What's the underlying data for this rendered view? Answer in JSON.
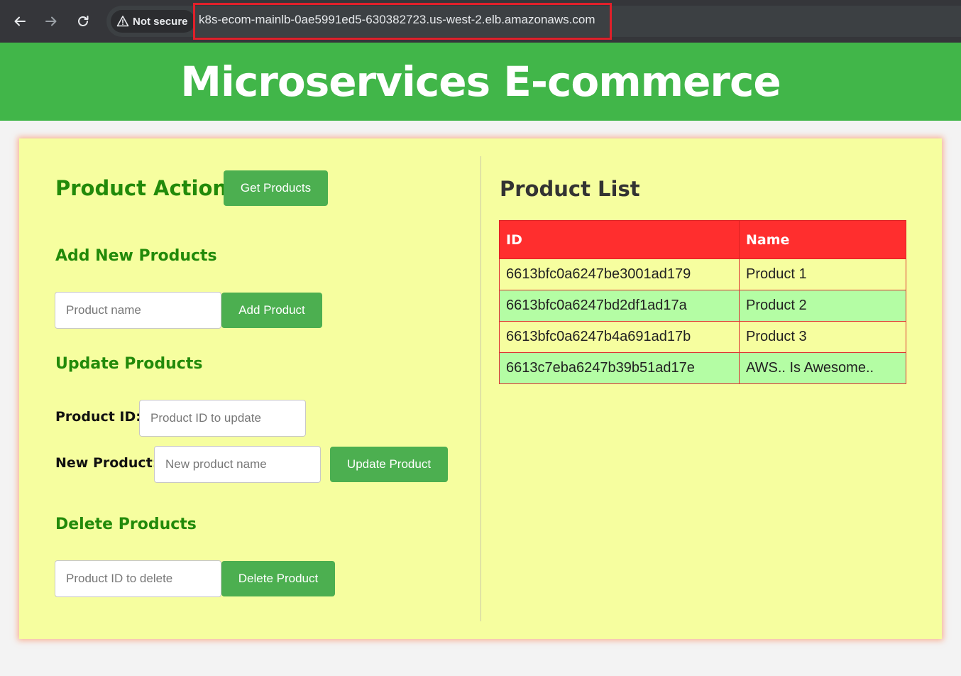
{
  "browser": {
    "security_label": "Not secure",
    "url": "k8s-ecom-mainlb-0ae5991ed5-630382723.us-west-2.elb.amazonaws.com"
  },
  "header": {
    "title": "Microservices E-commerce"
  },
  "actions": {
    "title": "Product Actions",
    "get_button": "Get Products",
    "add": {
      "title": "Add New Products",
      "placeholder": "Product name",
      "button": "Add Product"
    },
    "update": {
      "title": "Update Products",
      "id_label": "Product ID:",
      "id_placeholder": "Product ID to update",
      "name_label": "New Product:",
      "name_placeholder": "New product name",
      "button": "Update Product"
    },
    "delete": {
      "title": "Delete Products",
      "placeholder": "Product ID to delete",
      "button": "Delete Product"
    }
  },
  "product_list": {
    "title": "Product List",
    "columns": [
      "ID",
      "Name"
    ],
    "rows": [
      {
        "id": "6613bfc0a6247be3001ad179",
        "name": "Product 1"
      },
      {
        "id": "6613bfc0a6247bd2df1ad17a",
        "name": "Product 2"
      },
      {
        "id": "6613bfc0a6247b4a691ad17b",
        "name": "Product 3"
      },
      {
        "id": "6613c7eba6247b39b51ad17e",
        "name": "AWS.. Is Awesome.."
      }
    ]
  },
  "colors": {
    "header_green": "#41b649",
    "panel_yellow": "#f6fe9f",
    "button_green": "#4caf50",
    "table_header_red": "#ff2e2e",
    "row_green": "#b4fda4",
    "section_title_green": "#228a0a"
  }
}
